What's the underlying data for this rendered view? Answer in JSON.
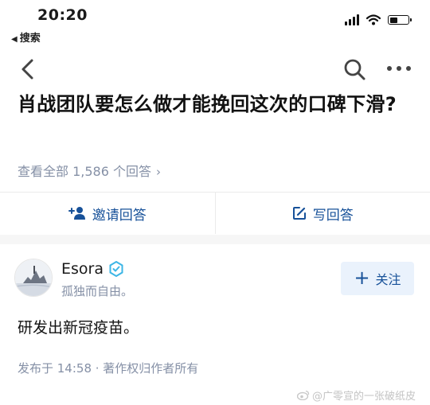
{
  "status_bar": {
    "time": "20:20",
    "back_app": "搜索"
  },
  "question": {
    "title": "肖战团队要怎么做才能挽回这次的口碑下滑?",
    "view_all": "查看全部 1,586 个回答"
  },
  "actions": {
    "invite": "邀请回答",
    "write": "写回答"
  },
  "answer": {
    "author_name": "Esora",
    "author_bio": "孤独而自由。",
    "follow_label": "关注",
    "content": "研发出新冠疫苗。",
    "meta": "发布于 14:58 · 著作权归作者所有"
  },
  "watermark": "@广零宣的一张破纸皮",
  "icons": {
    "back": "chevron-left-icon",
    "search": "search-icon",
    "more": "more-dots-icon",
    "invite": "add-person-icon",
    "write": "edit-icon",
    "badge": "verified-badge-icon"
  },
  "colors": {
    "link": "#175199",
    "muted": "#8590a6",
    "follow_bg": "#eaf2fc",
    "badge": "#3db6e6"
  }
}
